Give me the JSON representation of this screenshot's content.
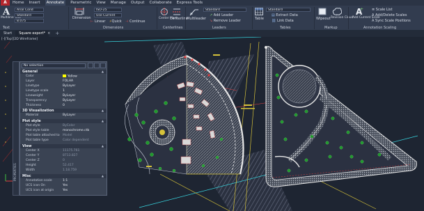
{
  "menu": {
    "items": [
      "Home",
      "Insert",
      "Annotate",
      "Parametric",
      "View",
      "Manage",
      "Output",
      "Collaborate",
      "Express Tools"
    ],
    "active_index": 2
  },
  "ribbon": {
    "text_panel": {
      "big_label": "Multiline Text",
      "font_value": "Arial Cond",
      "style_value": "Standard",
      "height_value": "8.075",
      "title": "Text"
    },
    "dimensions_panel": {
      "big_label": "Dimension",
      "style_value": "ISO-25",
      "layer_value": "Use Current",
      "linear_label": "Linear",
      "quick_label": "Quick",
      "continue_label": "Continue",
      "title": "Dimensions"
    },
    "centerlines_panel": {
      "center_mark": "Center Mark",
      "centerline": "Centerline",
      "title": "Centerlines"
    },
    "leaders_panel": {
      "multileader": "Multileader",
      "style_value": "Standard",
      "add_leader": "Add Leader",
      "remove_leader": "Remove Leader",
      "title": "Leaders"
    },
    "tables_panel": {
      "table": "Table",
      "style_value": "Standard",
      "extract_data": "Extract Data",
      "link_data": "Link Data",
      "title": "Tables"
    },
    "markup_panel": {
      "wipeout": "Wipeout",
      "revision_cloud": "Revision Cloud",
      "title": "Markup"
    },
    "scaling_panel": {
      "add_current_scale": "Add Current Scale",
      "scale_list": "Scale List",
      "add_delete_scales": "Add/Delete Scales",
      "sync_scale_positions": "Sync Scale Positions",
      "title": "Annotation Scaling"
    }
  },
  "file_tabs": {
    "items": [
      "Start",
      "Square export*"
    ],
    "active_index": 1,
    "add_symbol": "+"
  },
  "viewport": {
    "label": "[-][Top][2D Wireframe]"
  },
  "properties": {
    "side_label": "PROPERTIES",
    "selection": "No selection",
    "sections": {
      "general": "General",
      "viz3d": "3D Visualization",
      "plot": "Plot style",
      "view": "View",
      "misc": "Misc"
    },
    "general": [
      {
        "k": "Color",
        "v": "Yellow"
      },
      {
        "k": "Layer",
        "v": "FOLHA"
      },
      {
        "k": "Linetype",
        "v": "ByLayer"
      },
      {
        "k": "Linetype scale",
        "v": "1"
      },
      {
        "k": "Lineweight",
        "v": "ByLayer"
      },
      {
        "k": "Transparency",
        "v": "ByLayer"
      },
      {
        "k": "Thickness",
        "v": "0"
      }
    ],
    "viz3d": [
      {
        "k": "Material",
        "v": "ByLayer"
      }
    ],
    "plot": [
      {
        "k": "Plot style",
        "v": "ByColor"
      },
      {
        "k": "Plot style table",
        "v": "monochrome.ctb"
      },
      {
        "k": "Plot table attached to",
        "v": "Model"
      },
      {
        "k": "Plot table type",
        "v": "Color dependent"
      }
    ],
    "view": [
      {
        "k": "Center X",
        "v": "11175.761"
      },
      {
        "k": "Center Y",
        "v": "8713.827"
      },
      {
        "k": "Center Z",
        "v": "0"
      },
      {
        "k": "Height",
        "v": "52.417"
      },
      {
        "k": "Width",
        "v": "1.18.759"
      }
    ],
    "misc": [
      {
        "k": "Annotation scale",
        "v": "1:1"
      },
      {
        "k": "UCS icon On",
        "v": "Yes"
      },
      {
        "k": "UCS icon at origin",
        "v": "Yes"
      }
    ]
  },
  "colors": {
    "canvas": "#1e2532",
    "ribbon": "#323c4f",
    "accent_red": "#b3262c",
    "layer_yellow": "#ffff00",
    "hatch": "#9aa0aa",
    "tree_green": "#1f9a2c"
  }
}
